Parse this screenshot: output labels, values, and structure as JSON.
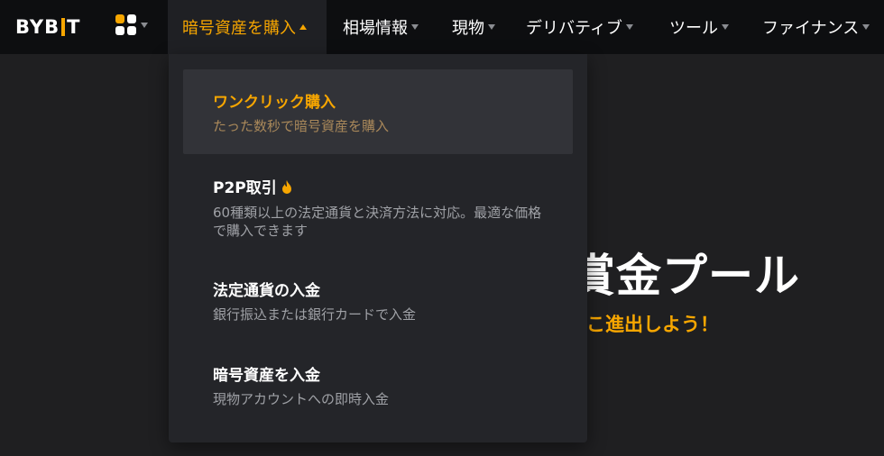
{
  "brand": {
    "logo_text_left": "BYB",
    "logo_text_right": "T"
  },
  "nav": {
    "items": [
      {
        "label": "暗号資産を購入",
        "active": true
      },
      {
        "label": "相場情報"
      },
      {
        "label": "現物"
      },
      {
        "label": "デリバティブ"
      },
      {
        "label": "ツール"
      },
      {
        "label": "ファイナンス"
      }
    ]
  },
  "dropdown": {
    "items": [
      {
        "title": "ワンクリック購入",
        "desc": "たった数秒で暗号資産を購入",
        "highlighted": true
      },
      {
        "title": "P2P取引",
        "desc": "60種類以上の法定通貨と決済方法に対応。最適な価格で購入できます",
        "icon": "fire-icon"
      },
      {
        "title": "法定通貨の入金",
        "desc": "銀行振込または銀行カードで入金"
      },
      {
        "title": "暗号資産を入金",
        "desc": "現物アカウントへの即時入金"
      }
    ]
  },
  "hero": {
    "title_partial": "賞金プール",
    "subtitle_partial": "こ進出しよう！"
  },
  "colors": {
    "accent": "#f7a600",
    "header_bg": "#0d0e10",
    "dropdown_bg": "#242529",
    "page_bg": "#1f1f21"
  }
}
